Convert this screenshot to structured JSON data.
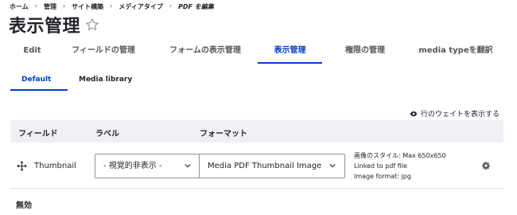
{
  "breadcrumb": {
    "items": [
      "ホーム",
      "管理",
      "サイト構築",
      "メディアタイプ",
      "PDF を編集"
    ]
  },
  "page": {
    "title": "表示管理"
  },
  "primary_tabs": [
    {
      "label": "Edit",
      "active": false
    },
    {
      "label": "フィールドの管理",
      "active": false
    },
    {
      "label": "フォームの表示管理",
      "active": false
    },
    {
      "label": "表示管理",
      "active": true
    },
    {
      "label": "権限の管理",
      "active": false
    },
    {
      "label": "media typeを翻訳",
      "active": false
    }
  ],
  "secondary_tabs": [
    {
      "label": "Default",
      "active": true
    },
    {
      "label": "Media library",
      "active": false
    }
  ],
  "row_weight_toggle": "行のウェイトを表示する",
  "table": {
    "headers": {
      "field": "フィールド",
      "label": "ラベル",
      "format": "フォーマット"
    },
    "rows": [
      {
        "field": "Thumbnail",
        "label_select": "- 視覚的非表示 -",
        "format_select": "Media PDF Thumbnail Image",
        "summary": [
          "画像のスタイル: Max 650x650",
          "Linked to pdf file",
          "Image format: jpg"
        ]
      }
    ]
  },
  "disabled_heading": "無効",
  "colors": {
    "accent": "#003ecc",
    "header_bg": "#eff0f3",
    "text": "#232429"
  }
}
